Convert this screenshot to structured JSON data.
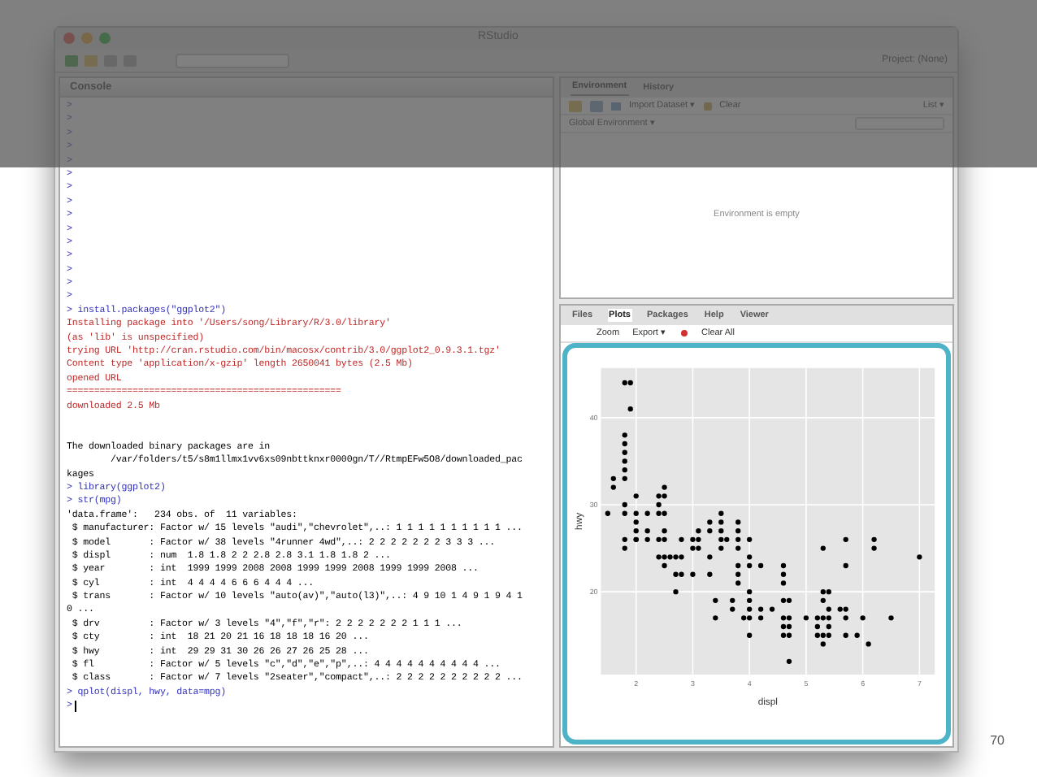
{
  "window": {
    "title": "RStudio"
  },
  "toolbar": {
    "project": "Project: (None)"
  },
  "console": {
    "title": "Console",
    "lines": [
      {
        "kind": "prompt",
        "text": ">"
      },
      {
        "kind": "prompt",
        "text": ">"
      },
      {
        "kind": "prompt",
        "text": ">"
      },
      {
        "kind": "prompt",
        "text": ">"
      },
      {
        "kind": "prompt",
        "text": ">"
      },
      {
        "kind": "prompt",
        "text": ">"
      },
      {
        "kind": "prompt",
        "text": ">"
      },
      {
        "kind": "prompt",
        "text": ">"
      },
      {
        "kind": "prompt",
        "text": ">"
      },
      {
        "kind": "prompt",
        "text": ">"
      },
      {
        "kind": "prompt",
        "text": ">"
      },
      {
        "kind": "prompt",
        "text": ">"
      },
      {
        "kind": "prompt",
        "text": ">"
      },
      {
        "kind": "prompt",
        "text": ">"
      },
      {
        "kind": "prompt",
        "text": ">"
      },
      {
        "kind": "input",
        "text": "> install.packages(\"ggplot2\")"
      },
      {
        "kind": "message",
        "text": "Installing package into '/Users/song/Library/R/3.0/library'"
      },
      {
        "kind": "message",
        "text": "(as 'lib' is unspecified)"
      },
      {
        "kind": "message",
        "text": "trying URL 'http://cran.rstudio.com/bin/macosx/contrib/3.0/ggplot2_0.9.3.1.tgz'"
      },
      {
        "kind": "message",
        "text": "Content type 'application/x-gzip' length 2650041 bytes (2.5 Mb)"
      },
      {
        "kind": "message",
        "text": "opened URL"
      },
      {
        "kind": "message",
        "text": "=================================================="
      },
      {
        "kind": "message",
        "text": "downloaded 2.5 Mb"
      },
      {
        "kind": "blank"
      },
      {
        "kind": "blank"
      },
      {
        "kind": "output",
        "text": "The downloaded binary packages are in"
      },
      {
        "kind": "output",
        "text": "        /var/folders/t5/s8m1llmx1vv6xs09nbttknxr0000gn/T//RtmpEFw5O8/downloaded_pac"
      },
      {
        "kind": "output",
        "text": "kages"
      },
      {
        "kind": "input",
        "text": "> library(ggplot2)"
      },
      {
        "kind": "input",
        "text": "> str(mpg)"
      },
      {
        "kind": "output",
        "text": "'data.frame':   234 obs. of  11 variables:"
      },
      {
        "kind": "output",
        "text": " $ manufacturer: Factor w/ 15 levels \"audi\",\"chevrolet\",..: 1 1 1 1 1 1 1 1 1 1 ..."
      },
      {
        "kind": "output",
        "text": " $ model       : Factor w/ 38 levels \"4runner 4wd\",..: 2 2 2 2 2 2 2 3 3 3 ..."
      },
      {
        "kind": "output",
        "text": " $ displ       : num  1.8 1.8 2 2 2.8 2.8 3.1 1.8 1.8 2 ..."
      },
      {
        "kind": "output",
        "text": " $ year        : int  1999 1999 2008 2008 1999 1999 2008 1999 1999 2008 ..."
      },
      {
        "kind": "output",
        "text": " $ cyl         : int  4 4 4 4 6 6 6 4 4 4 ..."
      },
      {
        "kind": "output",
        "text": " $ trans       : Factor w/ 10 levels \"auto(av)\",\"auto(l3)\",..: 4 9 10 1 4 9 1 9 4 1"
      },
      {
        "kind": "output",
        "text": "0 ..."
      },
      {
        "kind": "output",
        "text": " $ drv         : Factor w/ 3 levels \"4\",\"f\",\"r\": 2 2 2 2 2 2 2 1 1 1 ..."
      },
      {
        "kind": "output",
        "text": " $ cty         : int  18 21 20 21 16 18 18 18 16 20 ..."
      },
      {
        "kind": "output",
        "text": " $ hwy         : int  29 29 31 30 26 26 27 26 25 28 ..."
      },
      {
        "kind": "output",
        "text": " $ fl          : Factor w/ 5 levels \"c\",\"d\",\"e\",\"p\",..: 4 4 4 4 4 4 4 4 4 4 ..."
      },
      {
        "kind": "output",
        "text": " $ class       : Factor w/ 7 levels \"2seater\",\"compact\",..: 2 2 2 2 2 2 2 2 2 2 ..."
      },
      {
        "kind": "input",
        "text": "> qplot(displ, hwy, data=mpg)"
      },
      {
        "kind": "cursor",
        "text": ">"
      }
    ]
  },
  "environment": {
    "tabs": [
      {
        "label": "Environment",
        "selected": true
      },
      {
        "label": "History",
        "selected": false
      }
    ],
    "toolbar": [
      {
        "kind": "import",
        "label": "Import Dataset ▾"
      },
      {
        "kind": "clear",
        "label": "Clear"
      }
    ],
    "view": "List ▾",
    "scope": "Global Environment ▾",
    "message": "Environment is empty"
  },
  "plots_pane": {
    "tabs": [
      {
        "label": "Files",
        "selected": false
      },
      {
        "label": "Plots",
        "selected": true
      },
      {
        "label": "Packages",
        "selected": false
      },
      {
        "label": "Help",
        "selected": false
      },
      {
        "label": "Viewer",
        "selected": false
      }
    ],
    "toolbar": [
      {
        "kind": "zoom",
        "label": "Zoom"
      },
      {
        "kind": "export",
        "label": "Export ▾"
      },
      {
        "kind": "remove"
      },
      {
        "kind": "clear",
        "label": "Clear All"
      }
    ],
    "chart_data": {
      "type": "scatter",
      "xlabel": "displ",
      "ylabel": "hwy",
      "xlim": [
        1.38,
        7.27
      ],
      "ylim": [
        10.5,
        45.7
      ],
      "xticks": [
        2,
        3,
        4,
        5,
        6,
        7
      ],
      "yticks": [
        20,
        30,
        40
      ],
      "grid": true,
      "x": [
        1.8,
        1.9,
        1.9,
        1.8,
        1.8,
        1.8,
        1.8,
        1.8,
        1.6,
        1.6,
        1.8,
        1.5,
        1.8,
        1.8,
        2.0,
        2.0,
        2.0,
        2.0,
        2.0,
        2.2,
        2.2,
        2.2,
        2.4,
        2.4,
        2.5,
        2.4,
        2.5,
        2.5,
        2.5,
        2.5,
        2.4,
        2.4,
        2.5,
        2.5,
        1.8,
        1.8,
        2.0,
        2.7,
        2.7,
        2.8,
        2.8,
        2.8,
        2.7,
        2.6,
        3.0,
        3.0,
        3.0,
        3.1,
        3.1,
        3.1,
        3.3,
        3.3,
        3.3,
        3.3,
        3.4,
        3.4,
        3.5,
        3.5,
        3.5,
        3.5,
        3.5,
        3.6,
        3.7,
        3.7,
        3.8,
        3.8,
        3.8,
        3.8,
        3.8,
        3.8,
        3.8,
        3.9,
        4.0,
        4.0,
        4.0,
        4.0,
        4.0,
        4.0,
        4.0,
        4.0,
        4.2,
        4.2,
        4.2,
        4.4,
        4.6,
        4.6,
        4.6,
        4.6,
        4.7,
        4.6,
        4.7,
        4.6,
        4.7,
        4.6,
        4.7,
        4.7,
        5.0,
        5.2,
        5.2,
        5.2,
        5.3,
        5.3,
        5.3,
        5.4,
        5.3,
        5.4,
        5.3,
        5.4,
        5.4,
        5.3,
        5.4,
        5.6,
        5.7,
        5.7,
        5.7,
        5.7,
        5.7,
        5.9,
        6.0,
        6.1,
        6.2,
        6.2,
        6.5,
        7.0
      ],
      "series": [
        {
          "color": "#000000",
          "values": [
            44,
            44,
            41,
            38,
            37,
            36,
            35,
            34,
            33,
            32,
            33,
            29,
            29,
            30,
            29,
            28,
            27,
            26,
            31,
            29,
            27,
            26,
            31,
            30,
            31,
            29,
            32,
            29,
            27,
            26,
            26,
            24,
            24,
            23,
            26,
            25,
            26,
            24,
            22,
            26,
            24,
            22,
            20,
            24,
            26,
            25,
            22,
            26,
            25,
            27,
            28,
            27,
            24,
            22,
            17,
            19,
            29,
            28,
            27,
            26,
            25,
            26,
            19,
            18,
            28,
            27,
            26,
            25,
            23,
            22,
            21,
            17,
            26,
            24,
            23,
            20,
            19,
            18,
            17,
            15,
            23,
            18,
            17,
            18,
            23,
            22,
            21,
            19,
            19,
            17,
            17,
            16,
            16,
            15,
            15,
            12,
            17,
            17,
            16,
            15,
            25,
            20,
            19,
            20,
            17,
            17,
            15,
            16,
            15,
            14,
            18,
            18,
            18,
            26,
            23,
            17,
            15,
            15,
            17,
            14,
            26,
            25,
            17,
            24
          ]
        }
      ]
    }
  },
  "slide_number": "70"
}
